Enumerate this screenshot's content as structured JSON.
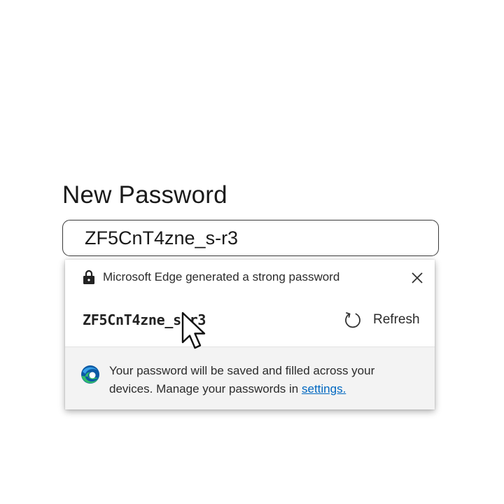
{
  "field": {
    "label": "New Password",
    "value": "ZF5CnT4zne_s-r3"
  },
  "popup": {
    "header_text": "Microsoft Edge generated a strong password",
    "generated_password": "ZF5CnT4zne_s-r3",
    "refresh_label": "Refresh",
    "footer_text_line1": "Your password will be saved and filled across your",
    "footer_text_line2": "devices. Manage your passwords in ",
    "settings_link": "settings."
  },
  "icons": {
    "lock": "lock-icon",
    "close": "close-icon",
    "refresh": "refresh-icon",
    "edge": "edge-icon",
    "cursor": "mouse-pointer-icon"
  },
  "colors": {
    "link": "#0067c0",
    "footer_background": "#f3f3f3",
    "edge_blue": "#0c59a4",
    "edge_green": "#2fbd6a"
  }
}
